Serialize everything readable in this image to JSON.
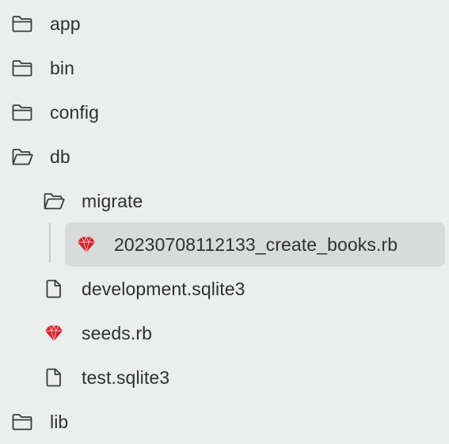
{
  "tree": {
    "items": [
      {
        "label": "app",
        "icon": "folder-icon"
      },
      {
        "label": "bin",
        "icon": "folder-icon"
      },
      {
        "label": "config",
        "icon": "folder-icon"
      },
      {
        "label": "db",
        "icon": "folder-open-icon"
      },
      {
        "label": "migrate",
        "icon": "folder-open-icon"
      },
      {
        "label": "20230708112133_create_books.rb",
        "icon": "ruby-icon",
        "selected": true
      },
      {
        "label": "development.sqlite3",
        "icon": "file-icon"
      },
      {
        "label": "seeds.rb",
        "icon": "ruby-icon"
      },
      {
        "label": "test.sqlite3",
        "icon": "file-icon"
      },
      {
        "label": "lib",
        "icon": "folder-icon"
      }
    ]
  },
  "colors": {
    "background": "#eceeed",
    "selection": "#d9dbda",
    "text": "#2f3030",
    "icon_stroke": "#3a3b3b",
    "ruby": "#d0242b"
  }
}
